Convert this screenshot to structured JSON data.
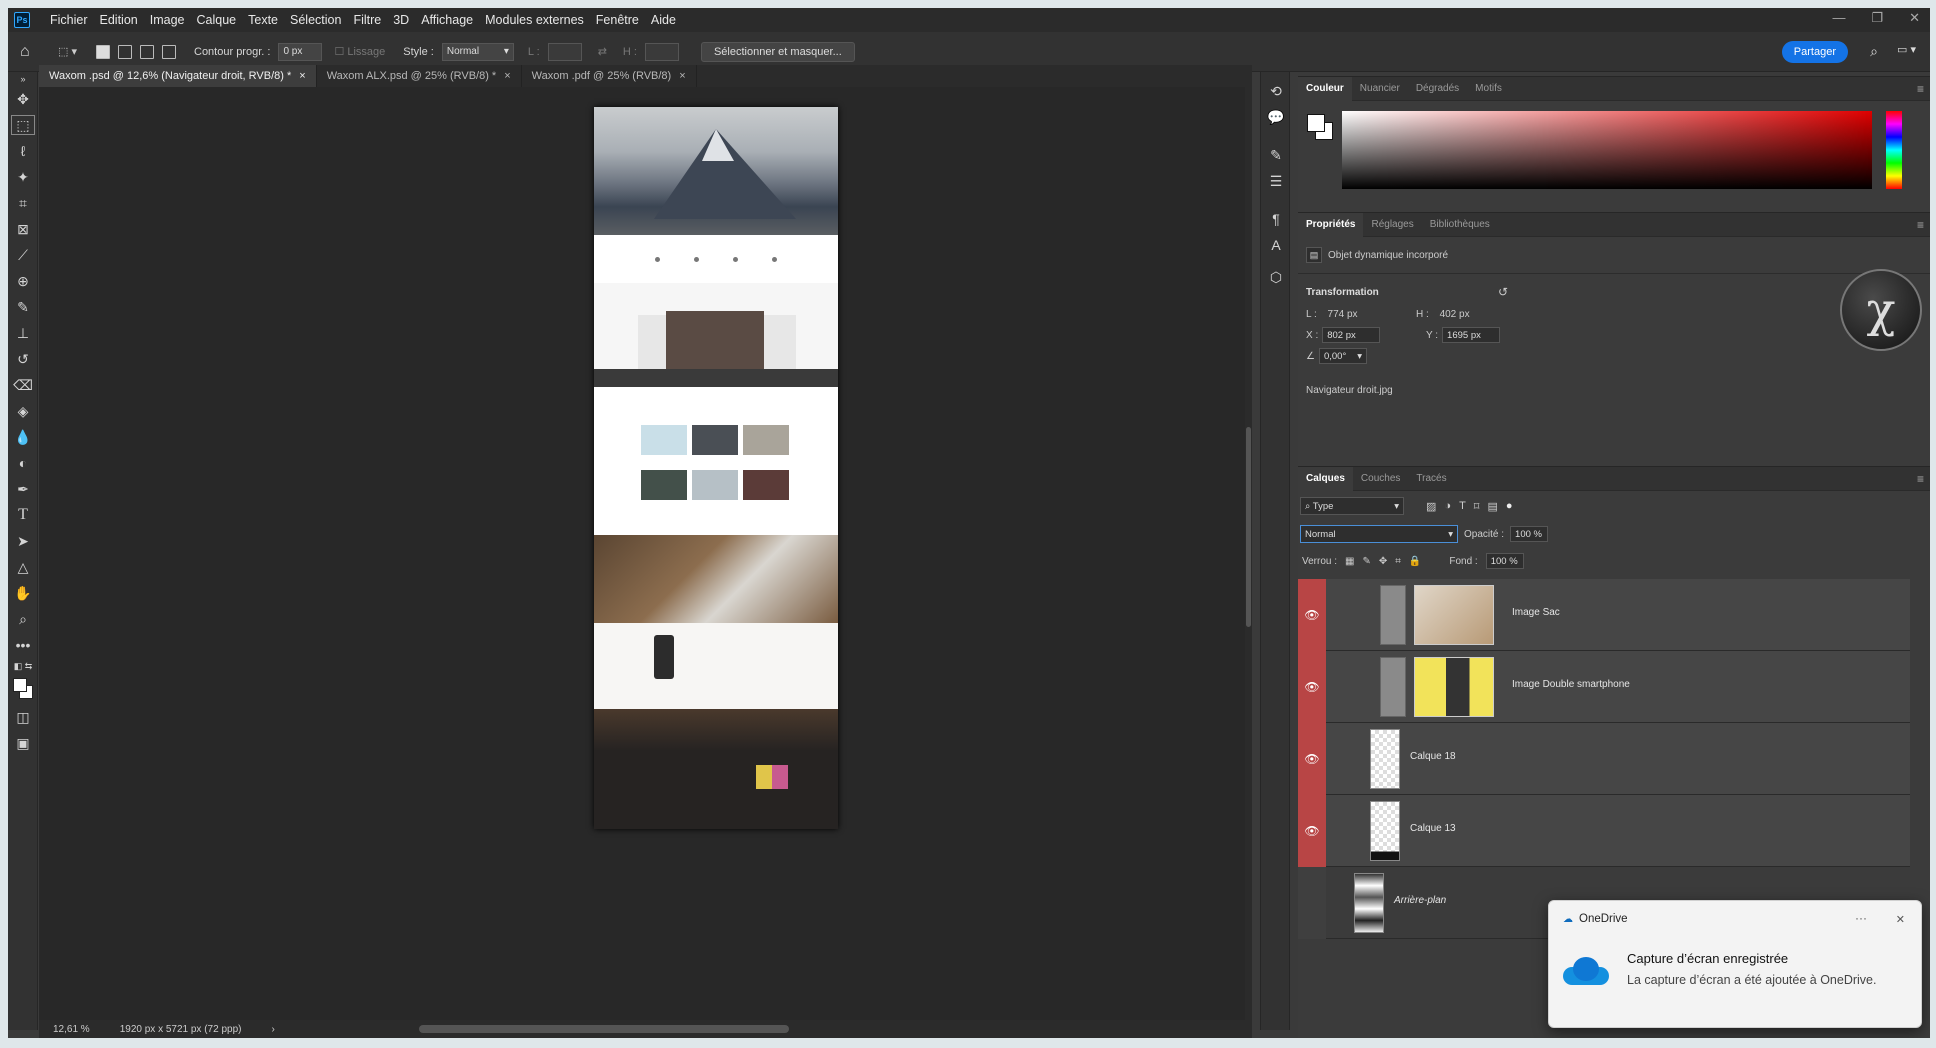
{
  "app": {
    "logo": "Ps"
  },
  "menu": [
    "Fichier",
    "Edition",
    "Image",
    "Calque",
    "Texte",
    "Sélection",
    "Filtre",
    "3D",
    "Affichage",
    "Modules externes",
    "Fenêtre",
    "Aide"
  ],
  "options": {
    "feather_label": "Contour progr. :",
    "feather_value": "0 px",
    "antialias_label": "Lissage",
    "style_label": "Style :",
    "style_value": "Normal",
    "width_label": "L :",
    "height_label": "H :",
    "select_mask": "Sélectionner et masquer...",
    "share": "Partager"
  },
  "tabs": [
    {
      "label": "Waxom .psd @ 12,6% (Navigateur droit, RVB/8) *",
      "close": "×"
    },
    {
      "label": "Waxom ALX.psd @ 25% (RVB/8) *",
      "close": "×"
    },
    {
      "label": "Waxom .pdf @ 25% (RVB/8)",
      "close": "×"
    }
  ],
  "status": {
    "zoom": "12,61 %",
    "doc_size": "1920 px x 5721 px (72 ppp)",
    "arrow": "›"
  },
  "color_panel": {
    "tabs": [
      "Couleur",
      "Nuancier",
      "Dégradés",
      "Motifs"
    ],
    "hue_color": "#e00000"
  },
  "properties": {
    "tabs": [
      "Propriétés",
      "Réglages",
      "Bibliothèques"
    ],
    "object_type": "Objet dynamique incorporé",
    "transform_title": "Transformation",
    "w_label": "L :",
    "w_value": "774 px",
    "h_label": "H :",
    "h_value": "402 px",
    "x_label": "X :",
    "x_value": "802 px",
    "y_label": "Y :",
    "y_value": "1695 px",
    "angle_value": "0,00°",
    "file_name": "Navigateur droit.jpg"
  },
  "layers_panel": {
    "tabs": [
      "Calques",
      "Couches",
      "Tracés"
    ],
    "filter": "Type",
    "blend_mode": "Normal",
    "opacity_label": "Opacité :",
    "opacity_value": "100 %",
    "lock_label": "Verrou :",
    "fill_label": "Fond :",
    "fill_value": "100 %",
    "layers": [
      {
        "name": "Image Sac",
        "visible": true
      },
      {
        "name": "Image Double smartphone",
        "visible": true
      },
      {
        "name": "Calque 18",
        "visible": true
      },
      {
        "name": "Calque 13",
        "visible": true
      },
      {
        "name": "Arrière-plan",
        "visible": false
      }
    ]
  },
  "toast": {
    "app": "OneDrive",
    "more": "···",
    "close": "✕",
    "title": "Capture d’écran enregistrée",
    "body": "La capture d’écran a été ajoutée à OneDrive."
  }
}
